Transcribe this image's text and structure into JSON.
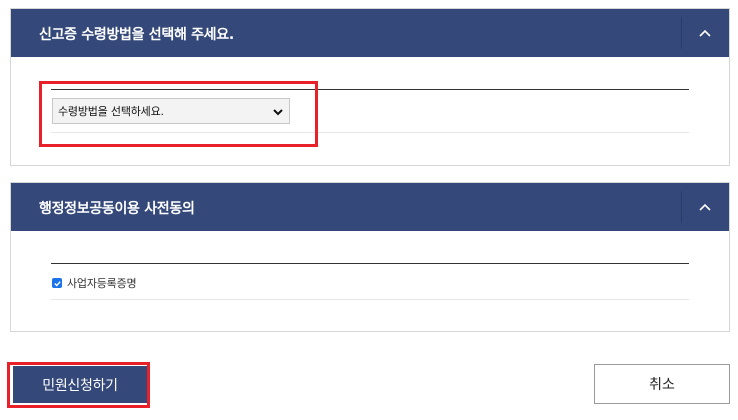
{
  "delivery_panel": {
    "title": "신고증 수령방법을 선택해 주세요.",
    "toggle_icon": "chevron-up-icon",
    "select": {
      "selected": "수령방법을 선택하세요."
    }
  },
  "consent_panel": {
    "title": "행정정보공동이용 사전동의",
    "toggle_icon": "chevron-up-icon",
    "checkbox": {
      "label": "사업자등록증명",
      "checked": true
    }
  },
  "actions": {
    "apply_label": "민원신청하기",
    "cancel_label": "취소"
  },
  "colors": {
    "header_bg": "#34497a",
    "highlight": "#e8202a",
    "checkbox": "#1a73e8"
  }
}
